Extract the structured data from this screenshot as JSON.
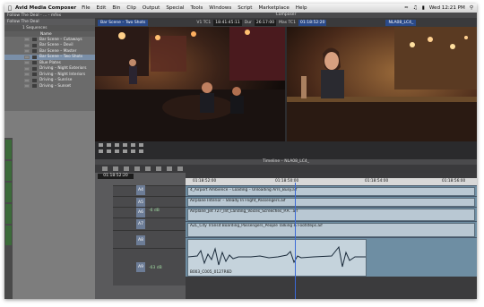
{
  "menubar": {
    "app": "Avid Media Composer",
    "items": [
      "File",
      "Edit",
      "Bin",
      "Clip",
      "Output",
      "Special",
      "Tools",
      "Windows",
      "Script",
      "Marketplace",
      "Help"
    ],
    "clock": "Wed 12:21 PM"
  },
  "bin": {
    "window_title": "Follow The Deal - ... - mfex",
    "name": "Follow The Deal",
    "tab": "1 Sequences",
    "column": "Name",
    "items": [
      "Bar Scene – Cutaways",
      "Bar Scene – Devil",
      "Bar Scene – Master",
      "Bar Scene – Two Shots",
      "Blue Plates",
      "Driving – Night Exteriors",
      "Driving – Night Interiors",
      "Driving – Sunrise",
      "Driving – Sunset"
    ],
    "selected_index": 3
  },
  "composer": {
    "title": "Composer",
    "source_clip": "Bar Scene – Two Shots",
    "v1_tc": "V1 TC1",
    "source_tc": "18:41:45:11",
    "dur_label": "Dur",
    "dur_value": "26:17:00",
    "mas_tc": "Mas TC1",
    "record_tc": "01:18:52:20",
    "sequence_name": "NLA08_LC4_"
  },
  "timeline": {
    "title": "Timeline – NLA08_LC4_",
    "timecode": "01:18:52:20",
    "ruler": [
      "01:18:52:00",
      "01:18:50:00",
      "01:18:54:00",
      "01:18:56:00"
    ],
    "tracks": [
      "A4",
      "A5",
      "A6",
      "A7",
      "A8",
      "A9"
    ],
    "levels": [
      "-6 dB",
      "-63 dB"
    ],
    "clips": [
      "4_Airport Ambience – Loading – Unloading Arrs_Busy.aif",
      "Airplane Interior – Steady In Flight_Passengers.aif",
      "Airplane_Jet 727_Int_Landing_Voices_Screeches_P.A. .aif",
      "AZL_City Transit Boarding_Passengers_People Talking & Footsteps.aif",
      "B003_C005_0127R6D"
    ]
  }
}
